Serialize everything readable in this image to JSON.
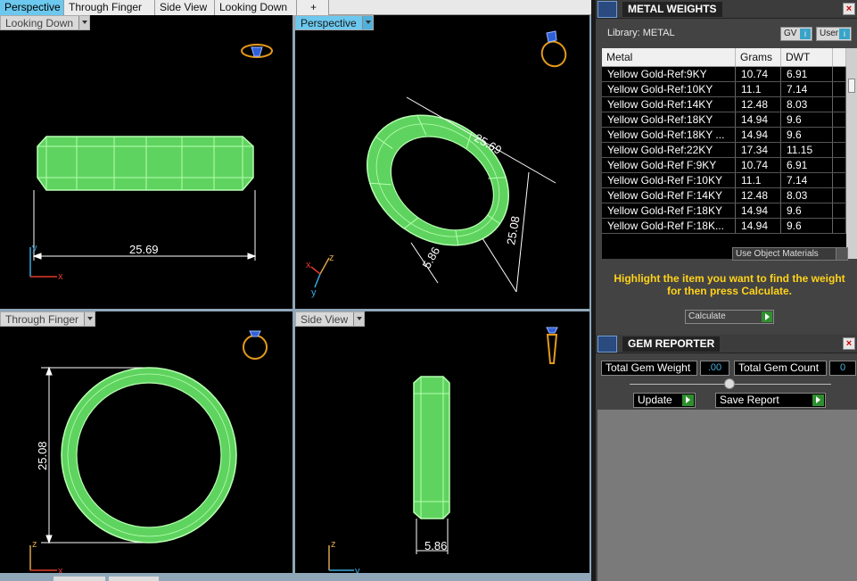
{
  "tabs": [
    {
      "label": "Perspective",
      "active": true
    },
    {
      "label": "Through Finger",
      "active": false
    },
    {
      "label": "Side View",
      "active": false
    },
    {
      "label": "Looking Down",
      "active": false
    },
    {
      "label": "+",
      "active": false
    }
  ],
  "viewports": {
    "top_left": {
      "label": "Looking Down",
      "dimension": "25.69",
      "axes": [
        "y",
        "x"
      ]
    },
    "top_right": {
      "label": "Perspective",
      "dimensions": [
        "25.69",
        "25.08",
        "5.86"
      ],
      "axes": [
        "z",
        "x",
        "y"
      ]
    },
    "bottom_left": {
      "label": "Through Finger",
      "dimension": "25.08",
      "axes": [
        "z",
        "x"
      ]
    },
    "bottom_right": {
      "label": "Side View",
      "dimension": "5.86",
      "axes": [
        "z",
        "y"
      ]
    }
  },
  "metal_weights": {
    "title": "METAL WEIGHTS",
    "library_label": "Library: METAL",
    "gv_button": "GV",
    "user_button": "User",
    "columns": [
      "Metal",
      "Grams",
      "DWT"
    ],
    "rows": [
      [
        "Yellow Gold-Ref:9KY",
        "10.74",
        "6.91"
      ],
      [
        "Yellow Gold-Ref:10KY",
        "11.1",
        "7.14"
      ],
      [
        "Yellow Gold-Ref:14KY",
        "12.48",
        "8.03"
      ],
      [
        "Yellow Gold-Ref:18KY",
        "14.94",
        "9.6"
      ],
      [
        "Yellow Gold-Ref:18KY ...",
        "14.94",
        "9.6"
      ],
      [
        "Yellow Gold-Ref:22KY",
        "17.34",
        "11.15"
      ],
      [
        "Yellow Gold-Ref F:9KY",
        "10.74",
        "6.91"
      ],
      [
        "Yellow Gold-Ref F:10KY",
        "11.1",
        "7.14"
      ],
      [
        "Yellow Gold-Ref F:14KY",
        "12.48",
        "8.03"
      ],
      [
        "Yellow Gold-Ref F:18KY",
        "14.94",
        "9.6"
      ],
      [
        "Yellow Gold-Ref F:18K...",
        "14.94",
        "9.6"
      ]
    ],
    "use_object_materials": "Use Object Materials",
    "hint": "Highlight the item you want to find the weight for then press Calculate.",
    "calculate_label": "Calculate"
  },
  "gem_reporter": {
    "title": "GEM REPORTER",
    "total_weight_label": "Total Gem Weight",
    "total_weight_value": ".00",
    "total_count_label": "Total Gem Count",
    "total_count_value": "0",
    "update_label": "Update",
    "save_report_label": "Save Report"
  },
  "colors": {
    "ring_fill": "#5fd35f",
    "ring_edge": "#b6ffb0",
    "accent_tab": "#6cc8ee",
    "hint_text": "#ffd21a",
    "axis_x": "#e23a2a",
    "axis_y": "#3aa8e0",
    "axis_z": "#d8a24a"
  },
  "icons": [
    "ring-gizmo-icon",
    "metal-weights-icon",
    "gem-reporter-icon",
    "close-icon",
    "dropdown-arrow-icon"
  ]
}
